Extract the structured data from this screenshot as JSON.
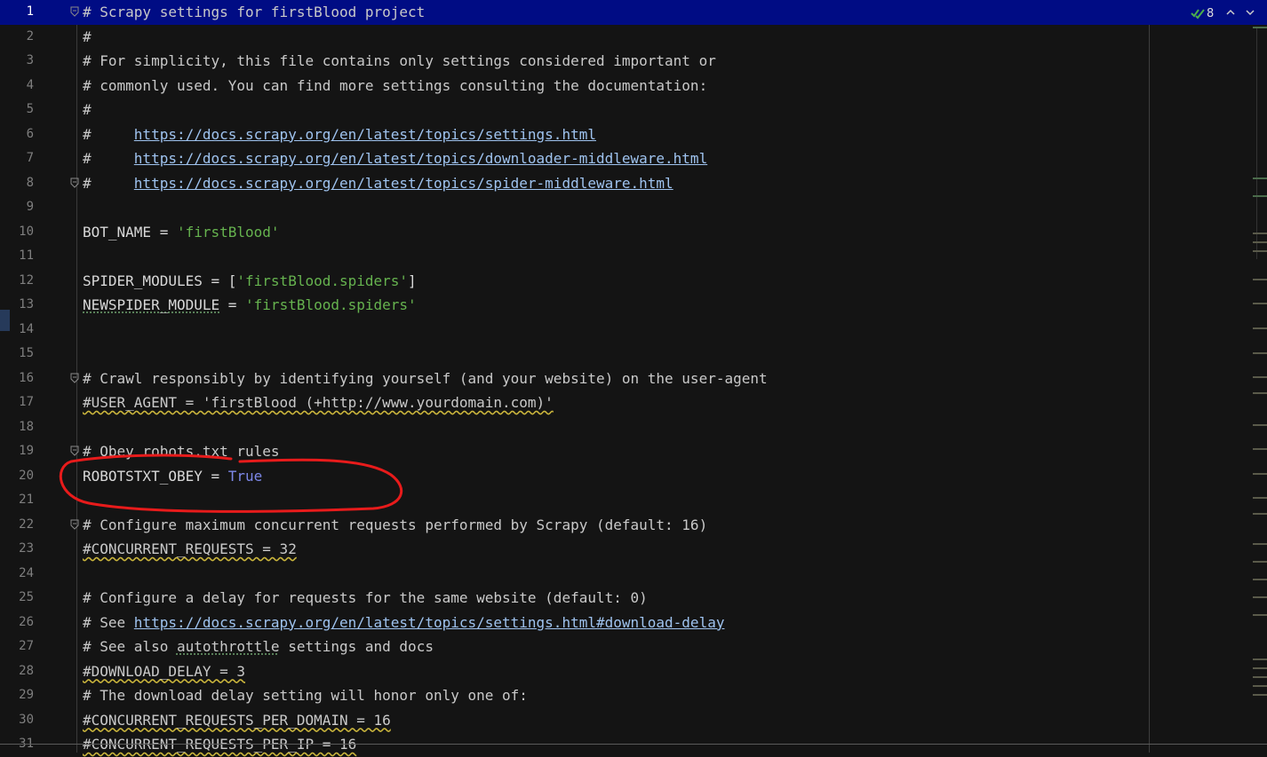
{
  "toolbar": {
    "inspection_count": "8",
    "inspection_icon": "double-check-icon",
    "prev_icon": "chevron-up-icon",
    "next_icon": "chevron-down-icon"
  },
  "colors": {
    "current_line": "#000c84",
    "background": "#141414",
    "string": "#66b34f",
    "keyword_true": "#7d88e8",
    "link": "#9fc3ef",
    "annotation_circle": "#e81b1b"
  },
  "lines": [
    {
      "n": "1",
      "parts": [
        {
          "t": "# Scrapy settings for firstBlood project",
          "c": "cmt"
        }
      ]
    },
    {
      "n": "2",
      "parts": [
        {
          "t": "#",
          "c": "cmt"
        }
      ]
    },
    {
      "n": "3",
      "parts": [
        {
          "t": "# For simplicity, this file contains only settings considered important or",
          "c": "cmt"
        }
      ]
    },
    {
      "n": "4",
      "parts": [
        {
          "t": "# commonly used. You can find more settings consulting the documentation:",
          "c": "cmt"
        }
      ]
    },
    {
      "n": "5",
      "parts": [
        {
          "t": "#",
          "c": "cmt"
        }
      ]
    },
    {
      "n": "6",
      "parts": [
        {
          "t": "#     ",
          "c": "cmt"
        },
        {
          "t": "https://docs.scrapy.org/en/latest/topics/settings.html",
          "c": "lnk"
        }
      ]
    },
    {
      "n": "7",
      "parts": [
        {
          "t": "#     ",
          "c": "cmt"
        },
        {
          "t": "https://docs.scrapy.org/en/latest/topics/downloader-middleware.html",
          "c": "lnk"
        }
      ]
    },
    {
      "n": "8",
      "parts": [
        {
          "t": "#     ",
          "c": "cmt"
        },
        {
          "t": "https://docs.scrapy.org/en/latest/topics/spider-middleware.html",
          "c": "lnk"
        }
      ]
    },
    {
      "n": "9",
      "parts": []
    },
    {
      "n": "10",
      "parts": [
        {
          "t": "BOT_NAME = ",
          "c": "kw"
        },
        {
          "t": "'firstBlood'",
          "c": "str"
        }
      ]
    },
    {
      "n": "11",
      "parts": []
    },
    {
      "n": "12",
      "parts": [
        {
          "t": "SPIDER_MODULES = [",
          "c": "kw"
        },
        {
          "t": "'firstBlood.spiders'",
          "c": "str"
        },
        {
          "t": "]",
          "c": "kw"
        }
      ]
    },
    {
      "n": "13",
      "parts": [
        {
          "t": "NEWSPIDER_MODULE",
          "c": "kw warn-g"
        },
        {
          "t": " = ",
          "c": "kw"
        },
        {
          "t": "'firstBlood.spiders'",
          "c": "str"
        }
      ]
    },
    {
      "n": "14",
      "parts": []
    },
    {
      "n": "15",
      "parts": []
    },
    {
      "n": "16",
      "parts": [
        {
          "t": "# Crawl responsibly by identifying yourself (and your website) on the user-agent",
          "c": "cmt"
        }
      ]
    },
    {
      "n": "17",
      "parts": [
        {
          "t": "#USER_AGENT = 'firstBlood (+http://www.yourdomain.com)'",
          "c": "cmt warn"
        }
      ]
    },
    {
      "n": "18",
      "parts": []
    },
    {
      "n": "19",
      "parts": [
        {
          "t": "# Obey robots.txt rules",
          "c": "cmt"
        }
      ]
    },
    {
      "n": "20",
      "parts": [
        {
          "t": "ROBOTSTXT_OBEY = ",
          "c": "kw"
        },
        {
          "t": "True",
          "c": "bool"
        }
      ]
    },
    {
      "n": "21",
      "parts": []
    },
    {
      "n": "22",
      "parts": [
        {
          "t": "# Configure maximum concurrent requests performed by Scrapy (default: 16)",
          "c": "cmt"
        }
      ]
    },
    {
      "n": "23",
      "parts": [
        {
          "t": "#CONCURRENT_REQUESTS = 32",
          "c": "cmt warn"
        }
      ]
    },
    {
      "n": "24",
      "parts": []
    },
    {
      "n": "25",
      "parts": [
        {
          "t": "# Configure a delay for requests for the same website (default: 0)",
          "c": "cmt"
        }
      ]
    },
    {
      "n": "26",
      "parts": [
        {
          "t": "# See ",
          "c": "cmt"
        },
        {
          "t": "https://docs.scrapy.org/en/latest/topics/settings.html#download-delay",
          "c": "lnk"
        }
      ]
    },
    {
      "n": "27",
      "parts": [
        {
          "t": "# See also ",
          "c": "cmt"
        },
        {
          "t": "autothrottle",
          "c": "cmt warn-g"
        },
        {
          "t": " settings and docs",
          "c": "cmt"
        }
      ]
    },
    {
      "n": "28",
      "parts": [
        {
          "t": "#DOWNLOAD_DELAY = 3",
          "c": "cmt warn"
        }
      ]
    },
    {
      "n": "29",
      "parts": [
        {
          "t": "# The download delay setting will honor only one of:",
          "c": "cmt"
        }
      ]
    },
    {
      "n": "30",
      "parts": [
        {
          "t": "#CONCURRENT_REQUESTS_PER_DOMAIN = 16",
          "c": "cmt warn"
        }
      ]
    },
    {
      "n": "31",
      "parts": [
        {
          "t": "#CONCURRENT_REQUESTS_PER_IP = 16",
          "c": "cmt warn"
        }
      ]
    }
  ],
  "folds": [
    "1",
    "8",
    "16",
    "19",
    "22"
  ]
}
